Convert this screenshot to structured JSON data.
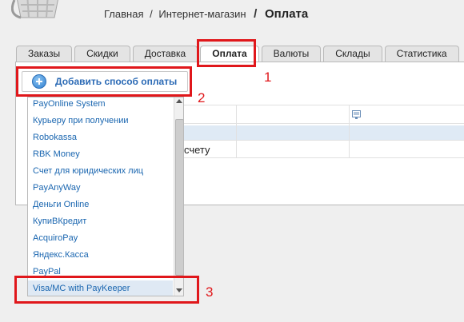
{
  "breadcrumb": {
    "home": "Главная",
    "sep": "/",
    "shop": "Интернет-магазин",
    "current_sep": "/",
    "current": "Оплата"
  },
  "tabs": [
    {
      "label": "Заказы",
      "active": false
    },
    {
      "label": "Скидки",
      "active": false
    },
    {
      "label": "Доставка",
      "active": false
    },
    {
      "label": "Оплата",
      "active": true
    },
    {
      "label": "Валюты",
      "active": false
    },
    {
      "label": "Склады",
      "active": false
    },
    {
      "label": "Статистика",
      "active": false
    }
  ],
  "add_button": {
    "label": "Добавить способ оплаты",
    "icon": "plus-circle-icon"
  },
  "table": {
    "cell_text": "счету"
  },
  "dropdown": {
    "items": [
      "PayOnline System",
      "Курьеру при получении",
      "Robokassa",
      "RBK Money",
      "Счет для юридических лиц",
      "PayAnyWay",
      "Деньги Online",
      "КупиВКредит",
      "AcquiroPay",
      "Яндекс.Касса",
      "PayPal"
    ],
    "selected": "Visa/MC with PayKeeper"
  },
  "annotations": [
    "1",
    "2",
    "3"
  ],
  "colors": {
    "accent": "#2b6ab5",
    "annotation": "#e0171b",
    "selected_bg": "#dfe9f4"
  }
}
